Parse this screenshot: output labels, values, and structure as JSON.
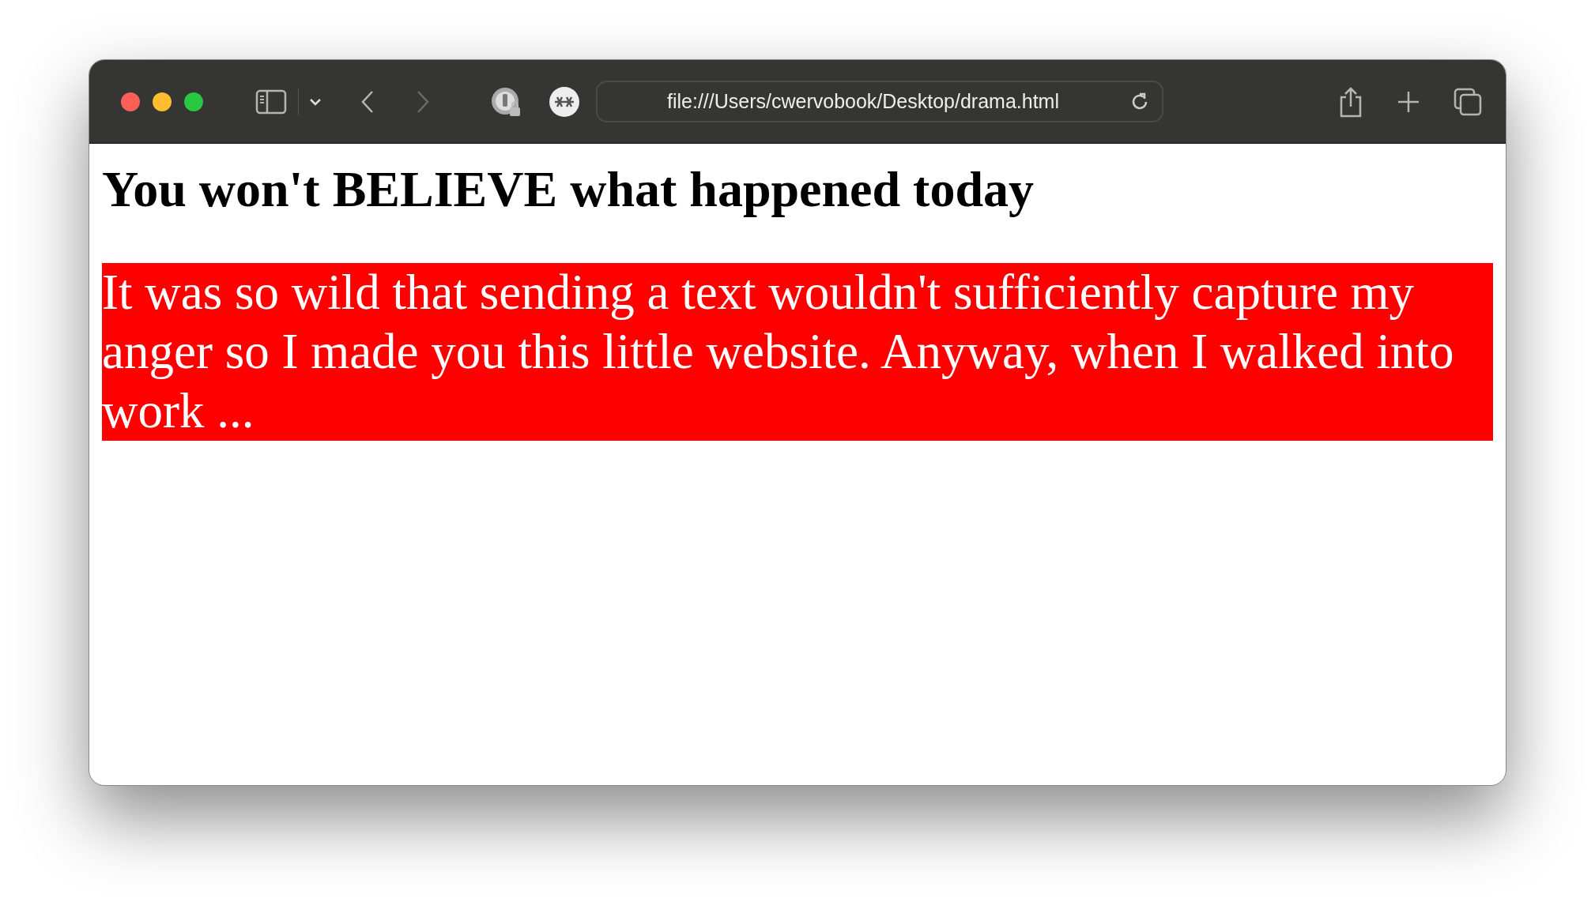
{
  "window": {
    "url": "file:///Users/cwervobook/Desktop/drama.html"
  },
  "page": {
    "heading": "You won't BELIEVE what happened today",
    "paragraph": "It was so wild that sending a text wouldn't sufficiently capture my anger so I made you this little website. Anyway, when I walked into work ..."
  }
}
